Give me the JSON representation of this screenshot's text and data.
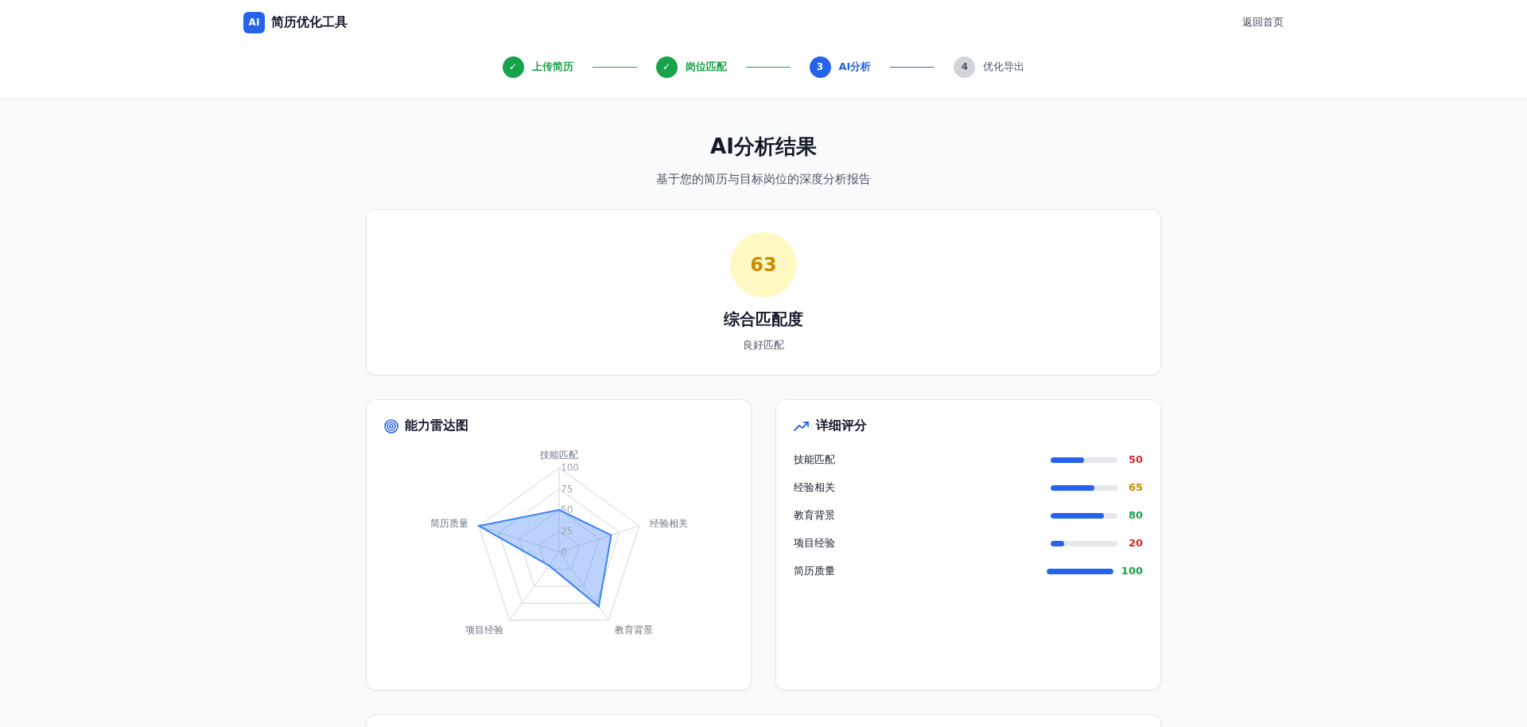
{
  "header": {
    "logo": "AI",
    "title": "简历优化工具",
    "home_link": "返回首页"
  },
  "steps": [
    {
      "number": "✓",
      "label": "上传简历",
      "kind": "done"
    },
    {
      "number": "✓",
      "label": "岗位匹配",
      "kind": "done"
    },
    {
      "number": "3",
      "label": "AI分析",
      "kind": "current"
    },
    {
      "number": "4",
      "label": "优化导出",
      "kind": "todo"
    }
  ],
  "page": {
    "title": "AI分析结果",
    "subtitle": "基于您的简历与目标岗位的深度分析报告"
  },
  "overall": {
    "score": "63",
    "title": "综合匹配度",
    "verdict": "良好匹配",
    "color": "#ca8a04"
  },
  "radar": {
    "title": "能力雷达图",
    "axes": [
      "技能匹配",
      "经验相关",
      "教育背景",
      "项目经验",
      "简历质量"
    ],
    "ticks": [
      "100",
      "75",
      "50",
      "25",
      "0"
    ]
  },
  "details": {
    "title": "详细评分",
    "items": [
      {
        "label": "技能匹配",
        "level": 0.5,
        "score": "50",
        "color": "#dc2626"
      },
      {
        "label": "经验相关",
        "level": 0.65,
        "score": "65",
        "color": "#ca8a04"
      },
      {
        "label": "教育背景",
        "level": 0.8,
        "score": "80",
        "color": "#16a34a"
      },
      {
        "label": "项目经验",
        "level": 0.2,
        "score": "20",
        "color": "#dc2626"
      },
      {
        "label": "简历质量",
        "level": 1,
        "score": "100",
        "color": "#16a34a"
      }
    ]
  }
}
